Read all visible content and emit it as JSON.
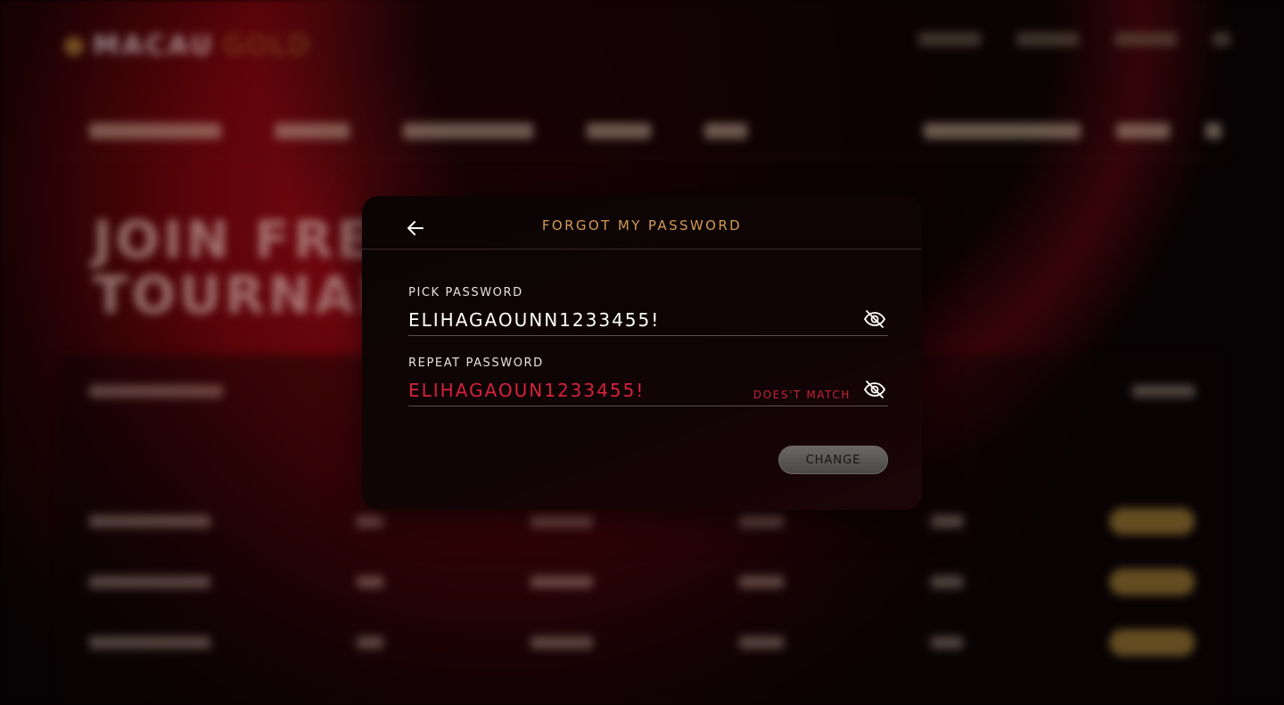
{
  "background": {
    "logo_word1": "MACAU",
    "logo_word2": "GOLD",
    "hero_line1": "JOIN FREE",
    "hero_line2": "TOURNAMENTS"
  },
  "modal": {
    "title": "FORGOT MY PASSWORD",
    "back_icon": "arrow-left-icon",
    "pick": {
      "label": "PICK PASSWORD",
      "value": "ELIHAGAOUNN1233455!",
      "icon": "eye-off-icon"
    },
    "repeat": {
      "label": "REPEAT PASSWORD",
      "value": "ELIHAGAOUN1233455!",
      "error": "DOES'T MATCH",
      "icon": "eye-off-icon"
    },
    "change_label": "CHANGE"
  },
  "colors": {
    "title_accent": "#d49a55",
    "error": "#d5233b",
    "background_red": "#8e0a14"
  }
}
